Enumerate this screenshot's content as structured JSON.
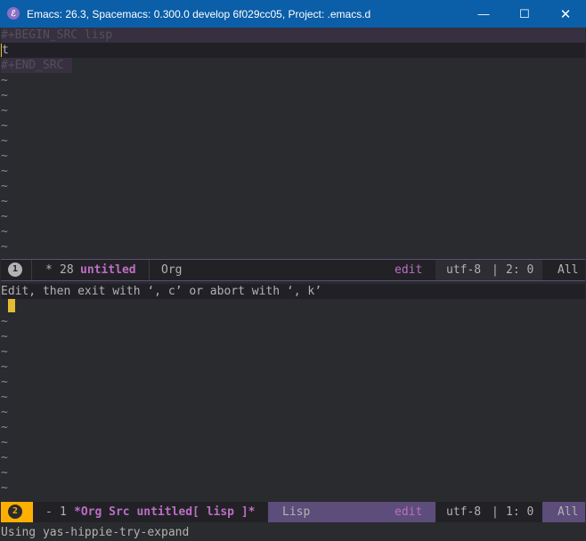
{
  "window": {
    "title": "Emacs: 26.3, Spacemacs: 0.300.0 develop 6f029cc05, Project: .emacs.d",
    "icon": "spacemacs-icon",
    "minimize_glyph": "—",
    "maximize_glyph": "☐",
    "close_glyph": "✕"
  },
  "top_buffer": {
    "begin_src": "#+BEGIN_SRC lisp",
    "code_line": "t",
    "end_src": "#+END_SRC",
    "tilde": "~"
  },
  "top_modeline": {
    "window_number": "1",
    "modified_indicator": "*",
    "size": "28",
    "buffer_name": "untitled",
    "major_mode": "Org",
    "state": "edit",
    "encoding": "utf-8",
    "separator": "|",
    "position": "2: 0",
    "scroll": "All"
  },
  "src_header": "Edit, then exit with ‘, c’ or abort with ‘, k’",
  "bottom_buffer": {
    "tilde": "~"
  },
  "bottom_modeline": {
    "window_number": "2",
    "modified_indicator": "-",
    "size": "1",
    "buffer_name": "*Org Src untitled[ lisp ]*",
    "major_mode": "Lisp",
    "state": "edit",
    "encoding": "utf-8",
    "separator": "|",
    "position": "1: 0",
    "scroll": "All"
  },
  "echo_area": "Using yas-hippie-try-expand",
  "colors": {
    "background": "#292b2e",
    "modeline_active": "#5d4d7a",
    "evil_state_badge": "#ffaf00",
    "keyword": "#bc6ec5",
    "cursor": "#e3bd31"
  }
}
